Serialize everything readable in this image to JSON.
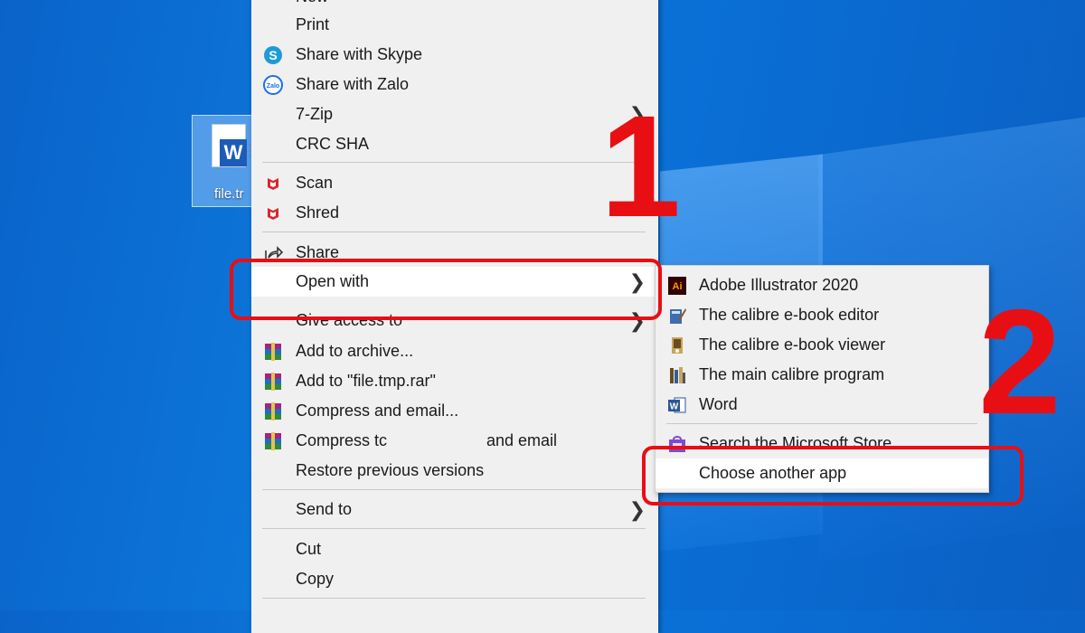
{
  "desktop": {
    "file_label": "file.tr"
  },
  "context_menu": {
    "items": [
      {
        "label": "New",
        "icon": "none"
      },
      {
        "label": "Print",
        "icon": "none"
      },
      {
        "label": "Share with Skype",
        "icon": "skype-icon"
      },
      {
        "label": "Share with Zalo",
        "icon": "zalo-icon"
      },
      {
        "label": "7-Zip",
        "icon": "none"
      },
      {
        "label": "CRC SHA",
        "icon": "none"
      },
      {
        "label": "Scan",
        "icon": "mcafee-icon"
      },
      {
        "label": "Shred",
        "icon": "mcafee-icon"
      },
      {
        "label": "Share",
        "icon": "share-icon"
      },
      {
        "label": "Open with",
        "icon": "none"
      },
      {
        "label": "Give access to",
        "icon": "none"
      },
      {
        "label": "Add to archive...",
        "icon": "winrar-icon"
      },
      {
        "label": "Add to \"file.tmp.rar\"",
        "icon": "winrar-icon"
      },
      {
        "label": "Compress and email...",
        "icon": "winrar-icon"
      },
      {
        "label": "Compress tc",
        "label_tail": "and email",
        "icon": "winrar-icon"
      },
      {
        "label": "Restore previous versions",
        "icon": "none"
      },
      {
        "label": "Send to",
        "icon": "none"
      },
      {
        "label": "Cut",
        "icon": "none"
      },
      {
        "label": "Copy",
        "icon": "none"
      }
    ],
    "chevron": "❯"
  },
  "submenu": {
    "items": [
      {
        "label": "Adobe Illustrator 2020",
        "icon": "illustrator-icon",
        "icon_text": "Ai"
      },
      {
        "label": "The calibre e-book editor",
        "icon": "calibre-editor-icon"
      },
      {
        "label": "The calibre e-book viewer",
        "icon": "calibre-viewer-icon"
      },
      {
        "label": "The main calibre program",
        "icon": "calibre-icon"
      },
      {
        "label": "Word",
        "icon": "word-icon",
        "icon_text": "W"
      },
      {
        "label": "Search the Microsoft Store",
        "icon": "store-icon"
      },
      {
        "label": "Choose another app",
        "icon": "none"
      }
    ]
  },
  "annotations": {
    "step1": "1",
    "step2": "2"
  },
  "colors": {
    "annotation_red": "#e80f14",
    "menu_bg": "#f0f0f0",
    "desktop_blue": "#0d79dc"
  }
}
